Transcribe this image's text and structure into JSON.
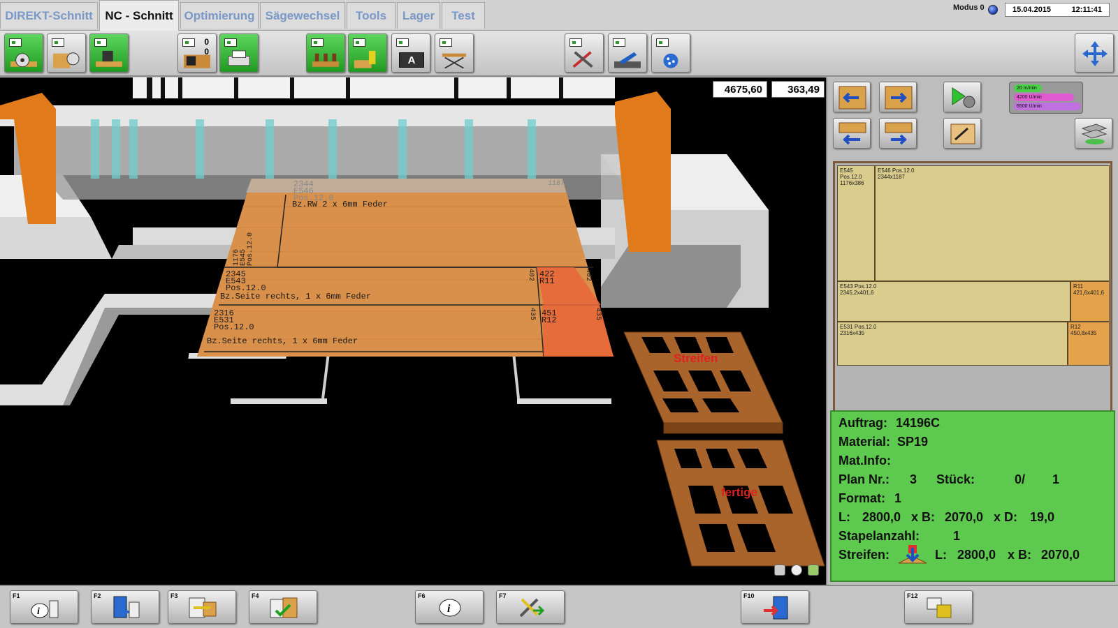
{
  "tabs": [
    {
      "label": "DIREKT-Schnitt",
      "active": false
    },
    {
      "label": "NC - Schnitt",
      "active": true
    },
    {
      "label": "Optimierung",
      "active": false
    },
    {
      "label": "Sägewechsel",
      "active": false
    },
    {
      "label": "Tools",
      "active": false
    },
    {
      "label": "Lager",
      "active": false
    },
    {
      "label": "Test",
      "active": false
    }
  ],
  "status": {
    "mode": "Modus 0",
    "date": "15.04.2015",
    "time": "12:11:41",
    "led_color": "#1d3fb0"
  },
  "toolbar": {
    "counter_top": "0",
    "counter_bottom": "0",
    "label_a": "A"
  },
  "viewport": {
    "coord_x": "4675,60",
    "coord_y": "363,49",
    "pallet_top_label": "Streifen",
    "pallet_bottom_label": "fertige",
    "board_lines": {
      "top_strip": "2344\nE546\nPos.12.0",
      "top_strip_note": "Bz.RW 2 x 6mm Feder",
      "left_strip": "1176\nE545\nPos.12.0",
      "top_dim": "1187",
      "mid_strip": "2345\nE543\nPos.12.0",
      "mid_note": "Bz.Seite rechts, 1 x 6mm Feder",
      "mid_dim": "402",
      "mid_rest": "422\nR11",
      "mid_rest_dim": "402",
      "bot_strip": "2316\nE531\nPos.12.0",
      "bot_note": "Bz.Seite rechts, 1 x 6mm Feder",
      "bot_dim": "435",
      "bot_rest": "451\nR12",
      "bot_rest_dim": "435"
    }
  },
  "speed": {
    "feed": "20 m/min",
    "rpm1": "4200 U/min",
    "rpm2": "6500 U/min"
  },
  "layout_parts": [
    {
      "name": "E545 Pos.12.0",
      "dims": "1176x386"
    },
    {
      "name": "E546 Pos.12.0",
      "dims": "2344x1187"
    },
    {
      "name": "E543 Pos.12.0",
      "dims": "2345,2x401,6"
    },
    {
      "name": "R11",
      "dims": "421,6x401,6"
    },
    {
      "name": "E531 Pos.12.0",
      "dims": "2316x435"
    },
    {
      "name": "R12",
      "dims": "450,8x435"
    }
  ],
  "info": {
    "auftrag_label": "Auftrag:",
    "auftrag": "14196C",
    "material_label": "Material:",
    "material": "SP19",
    "matinfo_label": "Mat.Info:",
    "plan_label": "Plan Nr.:",
    "plan": "3",
    "stueck_label": "Stück:",
    "stueck_done": "0/",
    "stueck_total": "1",
    "format_label": "Format:",
    "format": "1",
    "l_label": "L:",
    "l_val": "2800,0",
    "b_label": "x B:",
    "b_val": "2070,0",
    "d_label": "x D:",
    "d_val": "19,0",
    "stapel_label": "Stapelanzahl:",
    "stapel": "1",
    "streifen_label": "Streifen:",
    "s_l_label": "L:",
    "s_l": "2800,0",
    "s_b_label": "x B:",
    "s_b": "2070,0"
  },
  "fkeys": [
    {
      "key": "F1",
      "icon": "info-list-icon"
    },
    {
      "key": "F2",
      "icon": "book-arrow-icon"
    },
    {
      "key": "F3",
      "icon": "transfer-icon"
    },
    {
      "key": "F4",
      "icon": "checklist-icon"
    },
    {
      "key": "F6",
      "icon": "info-icon"
    },
    {
      "key": "F7",
      "icon": "tools-icon"
    },
    {
      "key": "F10",
      "icon": "exit-door-icon"
    },
    {
      "key": "F12",
      "icon": "windows-icon"
    }
  ]
}
